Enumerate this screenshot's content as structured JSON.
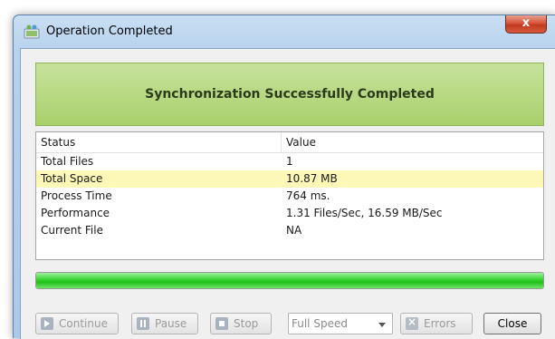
{
  "window": {
    "title": "Operation Completed",
    "close_glyph": "x"
  },
  "banner": {
    "text": "Synchronization Successfully Completed"
  },
  "table": {
    "headers": {
      "status": "Status",
      "value": "Value"
    },
    "rows": [
      {
        "name": "Total Files",
        "value": "1"
      },
      {
        "name": "Total Space",
        "value": "10.87 MB"
      },
      {
        "name": "Process Time",
        "value": "764 ms."
      },
      {
        "name": "Performance",
        "value": "1.31 Files/Sec, 16.59 MB/Sec"
      },
      {
        "name": "Current File",
        "value": "NA"
      }
    ],
    "highlighted_row": 1
  },
  "progress": {
    "percent": 100,
    "color": "#2ecc2a"
  },
  "toolbar": {
    "continue_label": "Continue",
    "pause_label": "Pause",
    "stop_label": "Stop",
    "speed_value": "Full Speed",
    "errors_label": "Errors",
    "close_label": "Close"
  },
  "icons": {
    "app": "sync-app-icon",
    "continue": "play-icon",
    "pause": "pause-icon",
    "stop": "stop-icon",
    "errors": "error-icon"
  },
  "colors": {
    "banner_bg": "#b8d985",
    "highlight_row": "#fdf7b8",
    "close_button": "#d7553c"
  }
}
